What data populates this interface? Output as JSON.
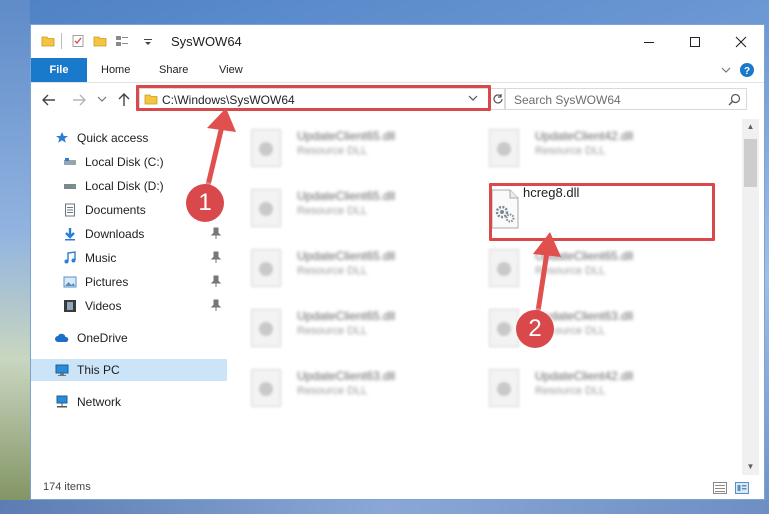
{
  "window": {
    "title": "SysWOW64",
    "minimize_icon": "minimize-icon",
    "maximize_icon": "maximize-icon",
    "close_icon": "close-icon"
  },
  "ribbon": {
    "tabs": [
      "File",
      "Home",
      "Share",
      "View"
    ],
    "accent": "#1979ca"
  },
  "address": {
    "path": "C:\\Windows\\SysWOW64",
    "search_placeholder": "Search SysWOW64"
  },
  "navpane": {
    "items": [
      {
        "label": "Quick access",
        "icon": "star-icon",
        "pinned": false
      },
      {
        "label": "Local Disk (C:)",
        "icon": "drive-icon",
        "pinned": false
      },
      {
        "label": "Local Disk (D:)",
        "icon": "drive-icon",
        "pinned": false
      },
      {
        "label": "Documents",
        "icon": "documents-icon",
        "pinned": false
      },
      {
        "label": "Downloads",
        "icon": "downloads-icon",
        "pinned": true
      },
      {
        "label": "Music",
        "icon": "music-icon",
        "pinned": true
      },
      {
        "label": "Pictures",
        "icon": "pictures-icon",
        "pinned": true
      },
      {
        "label": "Videos",
        "icon": "videos-icon",
        "pinned": true
      },
      {
        "label": "OneDrive",
        "icon": "cloud-icon",
        "pinned": false
      },
      {
        "label": "This PC",
        "icon": "computer-icon",
        "pinned": false,
        "selected": true
      },
      {
        "label": "Network",
        "icon": "network-icon",
        "pinned": false
      }
    ]
  },
  "files": [
    {
      "name": "UpdateClient65.dll",
      "type": "Resource DLL"
    },
    {
      "name": "UpdateClient42.dll",
      "type": "Resource DLL"
    },
    {
      "name": "UpdateClient65.dll",
      "type": "Resource DLL"
    },
    {
      "name": "hcreg8.dll",
      "type": "",
      "highlighted": true
    },
    {
      "name": "UpdateClient65.dll",
      "type": "Resource DLL"
    },
    {
      "name": "UpdateClient65.dll",
      "type": "Resource DLL"
    },
    {
      "name": "UpdateClient65.dll",
      "type": "Resource DLL"
    },
    {
      "name": "UpdateClient63.dll",
      "type": "Resource DLL"
    },
    {
      "name": "UpdateClient63.dll",
      "type": "Resource DLL"
    },
    {
      "name": "UpdateClient42.dll",
      "type": "Resource DLL"
    }
  ],
  "status": {
    "item_count": "174 items"
  },
  "annotations": {
    "step1": "1",
    "step2": "2",
    "color": "#d9484a"
  }
}
